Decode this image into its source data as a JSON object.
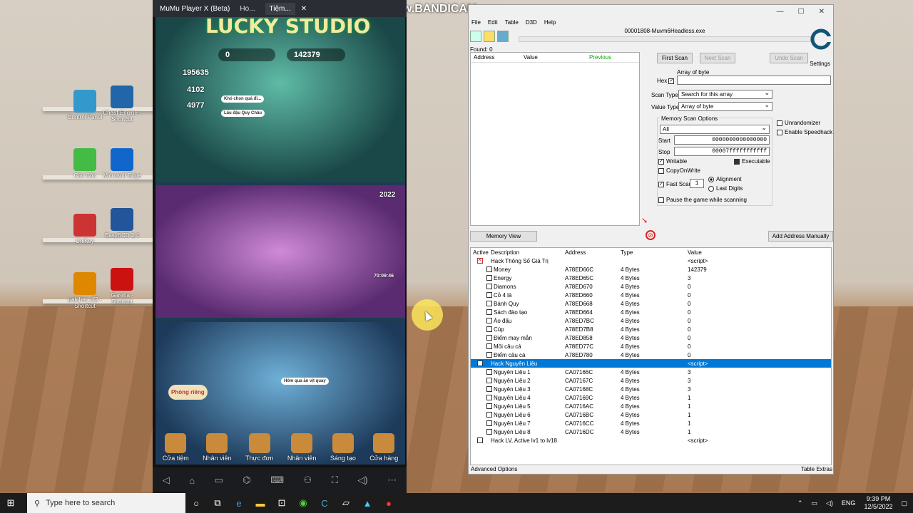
{
  "watermark": "www.BANDICAM.com",
  "desktop": {
    "icons": [
      {
        "label": "Control Panel"
      },
      {
        "label": "Cheat Engine - Shortcut"
      },
      {
        "label": "Cốc Cốc"
      },
      {
        "label": "Microsoft Edge"
      },
      {
        "label": "UniKey"
      },
      {
        "label": "EasyBCD 2.4"
      },
      {
        "label": "patcher_cf2 - Shortcut"
      },
      {
        "label": "Garena - Shortcut"
      }
    ]
  },
  "mumu": {
    "title": "MuMu Player X  (Beta)",
    "tabs": [
      "Ho...",
      "Tiệm..."
    ],
    "game": {
      "banner": "LUCKY STUDIO",
      "diamonds": "0",
      "cash": "142379",
      "stat1": "195635",
      "stat2": "4102",
      "stat3": "4977",
      "timer": "70:09:46",
      "year": "2022",
      "bubble1": "Khó chọn quá đi...",
      "bubble2": "Lẩu đậu Quy Châu",
      "bubble3": "Hôm qua ăn vịt quay",
      "room": "Phòng riêng",
      "nav": [
        "Cửa tiệm",
        "Nhân viên",
        "Thực đơn",
        "Nhân viên",
        "Sáng tạo",
        "Cửa hàng"
      ]
    }
  },
  "ce": {
    "process": "00001808-Muvm6Headless.exe",
    "menu": [
      "File",
      "Edit",
      "Table",
      "D3D",
      "Help"
    ],
    "found": "Found: 0",
    "results_headers": [
      "Address",
      "Value",
      "Previous"
    ],
    "first_scan": "First Scan",
    "next_scan": "Next Scan",
    "undo_scan": "Undo Scan",
    "settings": "Settings",
    "array_of_byte": "Array of byte",
    "hex": "Hex",
    "scan_type_label": "Scan Type",
    "scan_type": "Search for this array",
    "value_type_label": "Value Type",
    "value_type": "Array of byte",
    "mem_opts": "Memory Scan Options",
    "mem_region": "All",
    "start_label": "Start",
    "start": "0000000000000000",
    "stop_label": "Stop",
    "stop": "00007fffffffffff",
    "writable": "Writable",
    "executable": "Executable",
    "copyonwrite": "CopyOnWrite",
    "fastscan": "Fast Scan",
    "fastscan_val": "1",
    "alignment": "Alignment",
    "lastdigits": "Last Digits",
    "pause": "Pause the game while scanning",
    "unrandomizer": "Unrandomizer",
    "speedhack": "Enable Speedhack",
    "memory_view": "Memory View",
    "add_manual": "Add Address Manually",
    "table_headers": [
      "Active",
      "Description",
      "Address",
      "Type",
      "Value"
    ],
    "rows": [
      {
        "desc": "Hack Thông Số Giá Trị",
        "addr": "",
        "type": "",
        "val": "<script>",
        "lvl": 0,
        "x": true
      },
      {
        "desc": "Money",
        "addr": "A78ED66C",
        "type": "4 Bytes",
        "val": "142379",
        "lvl": 1
      },
      {
        "desc": "Energy",
        "addr": "A78ED65C",
        "type": "4 Bytes",
        "val": "3",
        "lvl": 1
      },
      {
        "desc": "Diamons",
        "addr": "A78ED670",
        "type": "4 Bytes",
        "val": "0",
        "lvl": 1
      },
      {
        "desc": "Cỏ 4 lá",
        "addr": "A78ED660",
        "type": "4 Bytes",
        "val": "0",
        "lvl": 1
      },
      {
        "desc": "Bánh Quy",
        "addr": "A78ED668",
        "type": "4 Bytes",
        "val": "0",
        "lvl": 1
      },
      {
        "desc": "Sách đào tạo",
        "addr": "A78ED664",
        "type": "4 Bytes",
        "val": "0",
        "lvl": 1
      },
      {
        "desc": "Áo đấu",
        "addr": "A78ED7BC",
        "type": "4 Bytes",
        "val": "0",
        "lvl": 1
      },
      {
        "desc": "Cúp",
        "addr": "A78ED7B8",
        "type": "4 Bytes",
        "val": "0",
        "lvl": 1
      },
      {
        "desc": "Điểm may mắn",
        "addr": "A78ED858",
        "type": "4 Bytes",
        "val": "0",
        "lvl": 1
      },
      {
        "desc": "Mồi câu cá",
        "addr": "A78ED77C",
        "type": "4 Bytes",
        "val": "0",
        "lvl": 1
      },
      {
        "desc": "Điểm câu cá",
        "addr": "A78ED780",
        "type": "4 Bytes",
        "val": "0",
        "lvl": 1
      },
      {
        "desc": "Hack Nguyên Liệu",
        "addr": "",
        "type": "",
        "val": "<script>",
        "lvl": 0,
        "selected": true
      },
      {
        "desc": "Nguyên Liệu 1",
        "addr": "CA07166C",
        "type": "4 Bytes",
        "val": "3",
        "lvl": 1
      },
      {
        "desc": "Nguyên Liệu 2",
        "addr": "CA07167C",
        "type": "4 Bytes",
        "val": "3",
        "lvl": 1
      },
      {
        "desc": "Nguyên Liệu 3",
        "addr": "CA07168C",
        "type": "4 Bytes",
        "val": "3",
        "lvl": 1
      },
      {
        "desc": "Nguyên Liệu 4",
        "addr": "CA07169C",
        "type": "4 Bytes",
        "val": "1",
        "lvl": 1
      },
      {
        "desc": "Nguyên Liệu 5",
        "addr": "CA0716AC",
        "type": "4 Bytes",
        "val": "1",
        "lvl": 1
      },
      {
        "desc": "Nguyên Liệu 6",
        "addr": "CA0716BC",
        "type": "4 Bytes",
        "val": "1",
        "lvl": 1
      },
      {
        "desc": "Nguyên Liệu 7",
        "addr": "CA0716CC",
        "type": "4 Bytes",
        "val": "1",
        "lvl": 1
      },
      {
        "desc": "Nguyên Liệu 8",
        "addr": "CA0716DC",
        "type": "4 Bytes",
        "val": "1",
        "lvl": 1
      },
      {
        "desc": "Hack LV, Active lv1 to lv18",
        "addr": "",
        "type": "",
        "val": "<script>",
        "lvl": 0
      }
    ],
    "advanced": "Advanced Options",
    "extras": "Table Extras"
  },
  "taskbar": {
    "search_placeholder": "Type here to search",
    "lang": "ENG",
    "time": "9:39 PM",
    "date": "12/5/2022"
  }
}
